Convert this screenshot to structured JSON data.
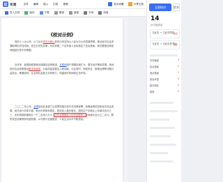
{
  "app": {
    "logo_text": "论易",
    "logo_mark": "论"
  },
  "toolbar": {
    "items": [
      "文件",
      "编辑",
      "插入",
      "引用",
      "视图"
    ],
    "right": [
      "校对设置",
      "分享文档"
    ]
  },
  "tabs": [
    "导入文档",
    "保存",
    "下载",
    "撤销",
    "重做",
    "字体",
    "段落"
  ],
  "document": {
    "title": "《校对示例》",
    "para1_a": "党的十八大以来，以习近平",
    "para1_mark": "同志为核心",
    "para1_b": "的党中央坚持以人民为中心的发展思想，推动经济社会发展取得历史性成就、发生历史性变革，为实现第二个百年奋斗目标奠定了坚实基础，我们要更加紧密地团结在党中央周围。",
    "para2_a": "近年来，我国网络基础设施建设加快推进，",
    "para2_mark": "互联网",
    "para2_b": "用户规模持续扩大，数字经济蓬勃发展，各地纷纷出台政策推动",
    "para2_mark2": "数字化转型",
    "para2_c": "，为高质量发展注入新动能。与此同时，网络安全、数据治理等问题日益突出，需要政府、企业和社会各方共同努力，构建良好的网络生态环境。",
    "para3_a": "二〇二二年以来，",
    "para3_mark": "全国",
    "para3_b": "各地区各部门认真贯彻落实党中央决策部署，统筹疫情防控和经济社会发展，经济运行总体平稳，就业形势基本稳定，居民收入稳步增长，国内生产总值比上年增长百分之三，全年城镇新增就业一千二百零六万人，",
    "para3_mark2": "全年全国居民人均可支配收入",
    "para3_c": "实际增长百分之二点九，脱贫攻坚成果得到巩固拓展，乡村振兴全面推进，人民生活水平不断提高。"
  },
  "panel": {
    "check_button": "立即校对",
    "more_button": "更多",
    "count": "14",
    "count_label": "处可能错误",
    "cards": [
      {
        "text": "习近平 → 习近平同志",
        "tag": "建议"
      },
      {
        "text": "习近平 → 习近平总书记",
        "tag": "建议"
      }
    ],
    "rows": [
      {
        "label": "字词错误",
        "num": "3"
      },
      {
        "label": "标点错误",
        "num": "2"
      },
      {
        "label": "语法错误",
        "num": "1"
      },
      {
        "label": "政治术语",
        "num": "4"
      },
      {
        "label": "数字规范",
        "num": "2"
      },
      {
        "label": "其他",
        "num": "2"
      }
    ]
  }
}
